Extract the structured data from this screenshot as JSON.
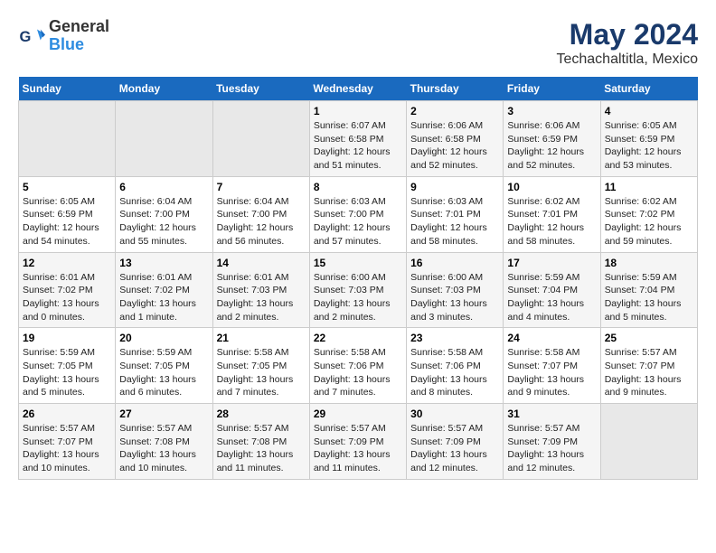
{
  "logo": {
    "line1": "General",
    "line2": "Blue"
  },
  "title": "May 2024",
  "subtitle": "Techachaltitla, Mexico",
  "days_header": [
    "Sunday",
    "Monday",
    "Tuesday",
    "Wednesday",
    "Thursday",
    "Friday",
    "Saturday"
  ],
  "weeks": [
    [
      {
        "day": "",
        "info": ""
      },
      {
        "day": "",
        "info": ""
      },
      {
        "day": "",
        "info": ""
      },
      {
        "day": "1",
        "info": "Sunrise: 6:07 AM\nSunset: 6:58 PM\nDaylight: 12 hours\nand 51 minutes."
      },
      {
        "day": "2",
        "info": "Sunrise: 6:06 AM\nSunset: 6:58 PM\nDaylight: 12 hours\nand 52 minutes."
      },
      {
        "day": "3",
        "info": "Sunrise: 6:06 AM\nSunset: 6:59 PM\nDaylight: 12 hours\nand 52 minutes."
      },
      {
        "day": "4",
        "info": "Sunrise: 6:05 AM\nSunset: 6:59 PM\nDaylight: 12 hours\nand 53 minutes."
      }
    ],
    [
      {
        "day": "5",
        "info": "Sunrise: 6:05 AM\nSunset: 6:59 PM\nDaylight: 12 hours\nand 54 minutes."
      },
      {
        "day": "6",
        "info": "Sunrise: 6:04 AM\nSunset: 7:00 PM\nDaylight: 12 hours\nand 55 minutes."
      },
      {
        "day": "7",
        "info": "Sunrise: 6:04 AM\nSunset: 7:00 PM\nDaylight: 12 hours\nand 56 minutes."
      },
      {
        "day": "8",
        "info": "Sunrise: 6:03 AM\nSunset: 7:00 PM\nDaylight: 12 hours\nand 57 minutes."
      },
      {
        "day": "9",
        "info": "Sunrise: 6:03 AM\nSunset: 7:01 PM\nDaylight: 12 hours\nand 58 minutes."
      },
      {
        "day": "10",
        "info": "Sunrise: 6:02 AM\nSunset: 7:01 PM\nDaylight: 12 hours\nand 58 minutes."
      },
      {
        "day": "11",
        "info": "Sunrise: 6:02 AM\nSunset: 7:02 PM\nDaylight: 12 hours\nand 59 minutes."
      }
    ],
    [
      {
        "day": "12",
        "info": "Sunrise: 6:01 AM\nSunset: 7:02 PM\nDaylight: 13 hours\nand 0 minutes."
      },
      {
        "day": "13",
        "info": "Sunrise: 6:01 AM\nSunset: 7:02 PM\nDaylight: 13 hours\nand 1 minute."
      },
      {
        "day": "14",
        "info": "Sunrise: 6:01 AM\nSunset: 7:03 PM\nDaylight: 13 hours\nand 2 minutes."
      },
      {
        "day": "15",
        "info": "Sunrise: 6:00 AM\nSunset: 7:03 PM\nDaylight: 13 hours\nand 2 minutes."
      },
      {
        "day": "16",
        "info": "Sunrise: 6:00 AM\nSunset: 7:03 PM\nDaylight: 13 hours\nand 3 minutes."
      },
      {
        "day": "17",
        "info": "Sunrise: 5:59 AM\nSunset: 7:04 PM\nDaylight: 13 hours\nand 4 minutes."
      },
      {
        "day": "18",
        "info": "Sunrise: 5:59 AM\nSunset: 7:04 PM\nDaylight: 13 hours\nand 5 minutes."
      }
    ],
    [
      {
        "day": "19",
        "info": "Sunrise: 5:59 AM\nSunset: 7:05 PM\nDaylight: 13 hours\nand 5 minutes."
      },
      {
        "day": "20",
        "info": "Sunrise: 5:59 AM\nSunset: 7:05 PM\nDaylight: 13 hours\nand 6 minutes."
      },
      {
        "day": "21",
        "info": "Sunrise: 5:58 AM\nSunset: 7:05 PM\nDaylight: 13 hours\nand 7 minutes."
      },
      {
        "day": "22",
        "info": "Sunrise: 5:58 AM\nSunset: 7:06 PM\nDaylight: 13 hours\nand 7 minutes."
      },
      {
        "day": "23",
        "info": "Sunrise: 5:58 AM\nSunset: 7:06 PM\nDaylight: 13 hours\nand 8 minutes."
      },
      {
        "day": "24",
        "info": "Sunrise: 5:58 AM\nSunset: 7:07 PM\nDaylight: 13 hours\nand 9 minutes."
      },
      {
        "day": "25",
        "info": "Sunrise: 5:57 AM\nSunset: 7:07 PM\nDaylight: 13 hours\nand 9 minutes."
      }
    ],
    [
      {
        "day": "26",
        "info": "Sunrise: 5:57 AM\nSunset: 7:07 PM\nDaylight: 13 hours\nand 10 minutes."
      },
      {
        "day": "27",
        "info": "Sunrise: 5:57 AM\nSunset: 7:08 PM\nDaylight: 13 hours\nand 10 minutes."
      },
      {
        "day": "28",
        "info": "Sunrise: 5:57 AM\nSunset: 7:08 PM\nDaylight: 13 hours\nand 11 minutes."
      },
      {
        "day": "29",
        "info": "Sunrise: 5:57 AM\nSunset: 7:09 PM\nDaylight: 13 hours\nand 11 minutes."
      },
      {
        "day": "30",
        "info": "Sunrise: 5:57 AM\nSunset: 7:09 PM\nDaylight: 13 hours\nand 12 minutes."
      },
      {
        "day": "31",
        "info": "Sunrise: 5:57 AM\nSunset: 7:09 PM\nDaylight: 13 hours\nand 12 minutes."
      },
      {
        "day": "",
        "info": ""
      }
    ]
  ]
}
